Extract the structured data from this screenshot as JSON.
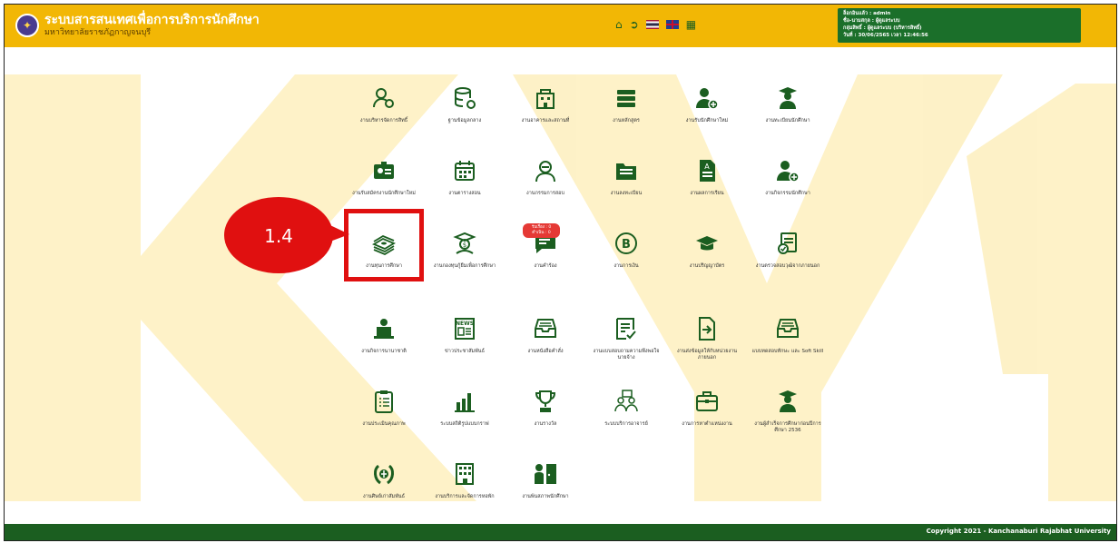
{
  "header": {
    "title": "ระบบสารสนเทศเพื่อการบริการนักศึกษา",
    "subtitle": "มหาวิทยาลัยราชภัฏกาญจนบุรี",
    "icons": [
      "home-icon",
      "logout-icon",
      "thai-flag-icon",
      "uk-flag-icon",
      "calendar-icon"
    ]
  },
  "user": {
    "line1": "ล็อกอินแล้ว : admin",
    "line2": "ชื่อ-นามสกุล : ผู้ดูแลระบบ",
    "line3": "กลุ่มสิทธิ์ : ผู้ดูแลระบบ (บริหารสิทธิ์)",
    "line4": "วันที่ : 30/06/2565 เวลา 12:46:56"
  },
  "tiles": [
    {
      "label": "งานบริหารจัดการสิทธิ์",
      "icon": "users-gear-icon"
    },
    {
      "label": "ฐานข้อมูลกลาง",
      "icon": "database-gear-icon"
    },
    {
      "label": "งานอาคารและสถานที่",
      "icon": "building-icon"
    },
    {
      "label": "งานหลักสูตร",
      "icon": "books-icon"
    },
    {
      "label": "งานรับนักศึกษาใหม่",
      "icon": "user-plus-icon"
    },
    {
      "label": "งานทะเบียนนักศึกษา",
      "icon": "graduate-icon"
    },
    {
      "label": "งานรับสมัครงานนักศึกษาใหม่",
      "icon": "id-card-icon"
    },
    {
      "label": "งานตารางสอน",
      "icon": "calendar-icon"
    },
    {
      "label": "งานกรรมการสอบ",
      "icon": "teacher-icon"
    },
    {
      "label": "งานลงทะเบียน",
      "icon": "folder-icon"
    },
    {
      "label": "งานผลการเรียน",
      "icon": "grade-doc-icon"
    },
    {
      "label": "งานกิจกรรมนักศึกษา",
      "icon": "user-plus-icon"
    },
    {
      "label": "งานทุนการศึกษา",
      "icon": "money-stack-icon"
    },
    {
      "label": "งานกองทุนกู้ยืมเพื่อการศึกษา",
      "icon": "student-loan-icon"
    },
    {
      "label": "งานคำร้อง",
      "icon": "message-icon"
    },
    {
      "label": "งานการเงิน",
      "icon": "baht-icon"
    },
    {
      "label": "งานปริญญาบัตร",
      "icon": "mortarboard-icon"
    },
    {
      "label": "งานตรวจสอบวุฒิจากภายนอก",
      "icon": "checklist-icon"
    },
    {
      "label": "งานกิจการนานาชาติ",
      "icon": "laptop-user-icon"
    },
    {
      "label": "ข่าวประชาสัมพันธ์",
      "icon": "news-icon"
    },
    {
      "label": "งานหนังสือคำสั่ง",
      "icon": "inbox-icon"
    },
    {
      "label": "งานแบบสอบถามความพึงพอใจนายจ้าง",
      "icon": "survey-icon"
    },
    {
      "label": "งานส่งข้อมูลให้กับหน่วยงานภายนอก",
      "icon": "export-icon"
    },
    {
      "label": "แบบทดสอบทักษะ และ Soft Skill",
      "icon": "inbox-icon"
    },
    {
      "label": "งานประเมินคุณภาพ",
      "icon": "clipboard-icon"
    },
    {
      "label": "ระบบสถิติรูปแบบกราฟ",
      "icon": "bar-chart-icon"
    },
    {
      "label": "งานรางวัล",
      "icon": "trophy-icon"
    },
    {
      "label": "ระบบบริการอาจารย์",
      "icon": "meeting-icon"
    },
    {
      "label": "งานการหาตำแหน่งงาน",
      "icon": "briefcase-icon"
    },
    {
      "label": "งานผู้สำเร็จการศึกษาก่อนปีการศึกษา 2536",
      "icon": "graduate-icon"
    },
    {
      "label": "งานศิษย์เก่าสัมพันธ์",
      "icon": "laurel-icon"
    },
    {
      "label": "งานบริการและจัดการหอพัก",
      "icon": "dormitory-icon"
    },
    {
      "label": "งานพ้นสภาพนักศึกษา",
      "icon": "exit-door-icon"
    }
  ],
  "badge": {
    "line1": "รับเรื่อง : 0",
    "line2": "ดำเนิน : 0"
  },
  "annotation": {
    "label": "1.4"
  },
  "footer": {
    "copyright": "Copyright 2021 - Kanchanaburi Rajabhat University"
  },
  "colors": {
    "header": "#f2b705",
    "accent": "#1b5e20",
    "highlight": "#e01010"
  }
}
